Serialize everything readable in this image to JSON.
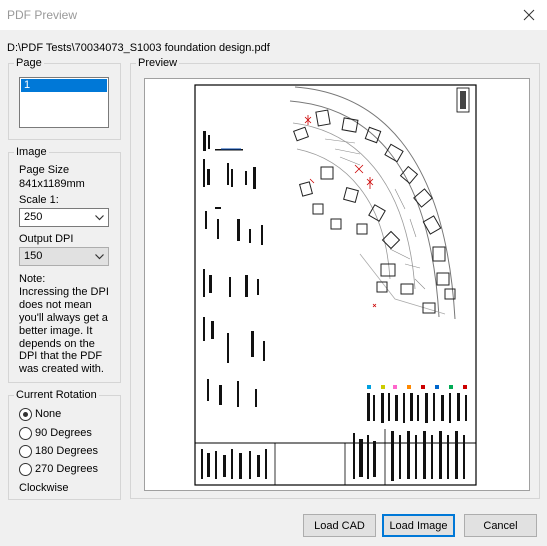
{
  "window": {
    "title": "PDF Preview"
  },
  "file_path": "D:\\PDF Tests\\70034073_S1003 foundation design.pdf",
  "page_group": {
    "legend": "Page",
    "items": [
      "1"
    ]
  },
  "image_group": {
    "legend": "Image",
    "page_size_label": "Page Size",
    "page_size_value": "841x1189mm",
    "scale_label": "Scale 1:",
    "scale_value": "250",
    "output_dpi_label": "Output DPI",
    "output_dpi_value": "150",
    "note_lines": [
      "Note:",
      "Incressing the DPI",
      "does not mean",
      "you'll always get a",
      "better image.  It",
      "depends on the",
      "DPI that the PDF",
      "was created with."
    ]
  },
  "rotation_group": {
    "legend": "Current Rotation",
    "options": [
      "None",
      "90 Degrees",
      "180 Degrees",
      "270 Degrees"
    ],
    "selected_index": 0,
    "direction": "Clockwise"
  },
  "preview_group": {
    "legend": "Preview"
  },
  "buttons": {
    "load_cad": "Load CAD",
    "load_image": "Load Image",
    "cancel": "Cancel"
  },
  "colors": {
    "selection": "#0078d7",
    "title_text": "#999999",
    "drawing_accent": "#cc0000"
  }
}
